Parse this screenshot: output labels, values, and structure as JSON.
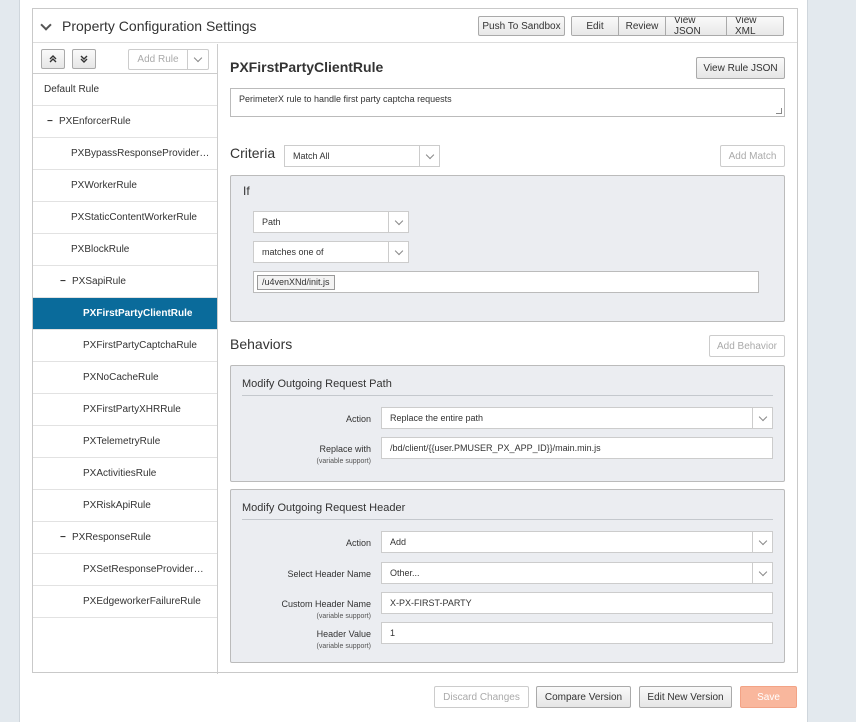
{
  "header": {
    "title": "Property Configuration Settings",
    "push_sandbox": "Push To Sandbox",
    "edit": "Edit",
    "review": "Review",
    "view_json": "View JSON",
    "view_xml": "View XML"
  },
  "sidebar": {
    "add_rule": "Add Rule",
    "items": [
      {
        "label": "Default Rule"
      },
      {
        "label": "PXEnforcerRule"
      },
      {
        "label": "PXBypassResponseProvider…"
      },
      {
        "label": "PXWorkerRule"
      },
      {
        "label": "PXStaticContentWorkerRule"
      },
      {
        "label": "PXBlockRule"
      },
      {
        "label": "PXSapiRule"
      },
      {
        "label": "PXFirstPartyClientRule"
      },
      {
        "label": "PXFirstPartyCaptchaRule"
      },
      {
        "label": "PXNoCacheRule"
      },
      {
        "label": "PXFirstPartyXHRRule"
      },
      {
        "label": "PXTelemetryRule"
      },
      {
        "label": "PXActivitiesRule"
      },
      {
        "label": "PXRiskApiRule"
      },
      {
        "label": "PXResponseRule"
      },
      {
        "label": "PXSetResponseProvider…"
      },
      {
        "label": "PXEdgeworkerFailureRule"
      }
    ]
  },
  "rule": {
    "name": "PXFirstPartyClientRule",
    "view_rule_json": "View Rule JSON",
    "description": "PerimeterX rule to handle first party captcha requests"
  },
  "criteria": {
    "label": "Criteria",
    "match": "Match All",
    "add_match": "Add Match",
    "if_label": "If",
    "field": "Path",
    "operator": "matches one of",
    "value": "/u4venXNd/init.js"
  },
  "behaviors": {
    "label": "Behaviors",
    "add_behavior": "Add Behavior",
    "path": {
      "title": "Modify Outgoing Request Path",
      "action_label": "Action",
      "action_value": "Replace the entire path",
      "replace_label": "Replace with",
      "variable_support": "(variable support)",
      "replace_value": "/bd/client/{{user.PMUSER_PX_APP_ID}}/main.min.js"
    },
    "header": {
      "title": "Modify Outgoing Request Header",
      "action_label": "Action",
      "action_value": "Add",
      "select_label": "Select Header Name",
      "select_value": "Other...",
      "custom_label": "Custom Header Name",
      "custom_value": "X-PX-FIRST-PARTY",
      "value_label": "Header Value",
      "value_value": "1",
      "variable_support": "(variable support)"
    }
  },
  "footer": {
    "discard": "Discard Changes",
    "compare": "Compare Version",
    "edit_new": "Edit New Version",
    "save": "Save"
  }
}
